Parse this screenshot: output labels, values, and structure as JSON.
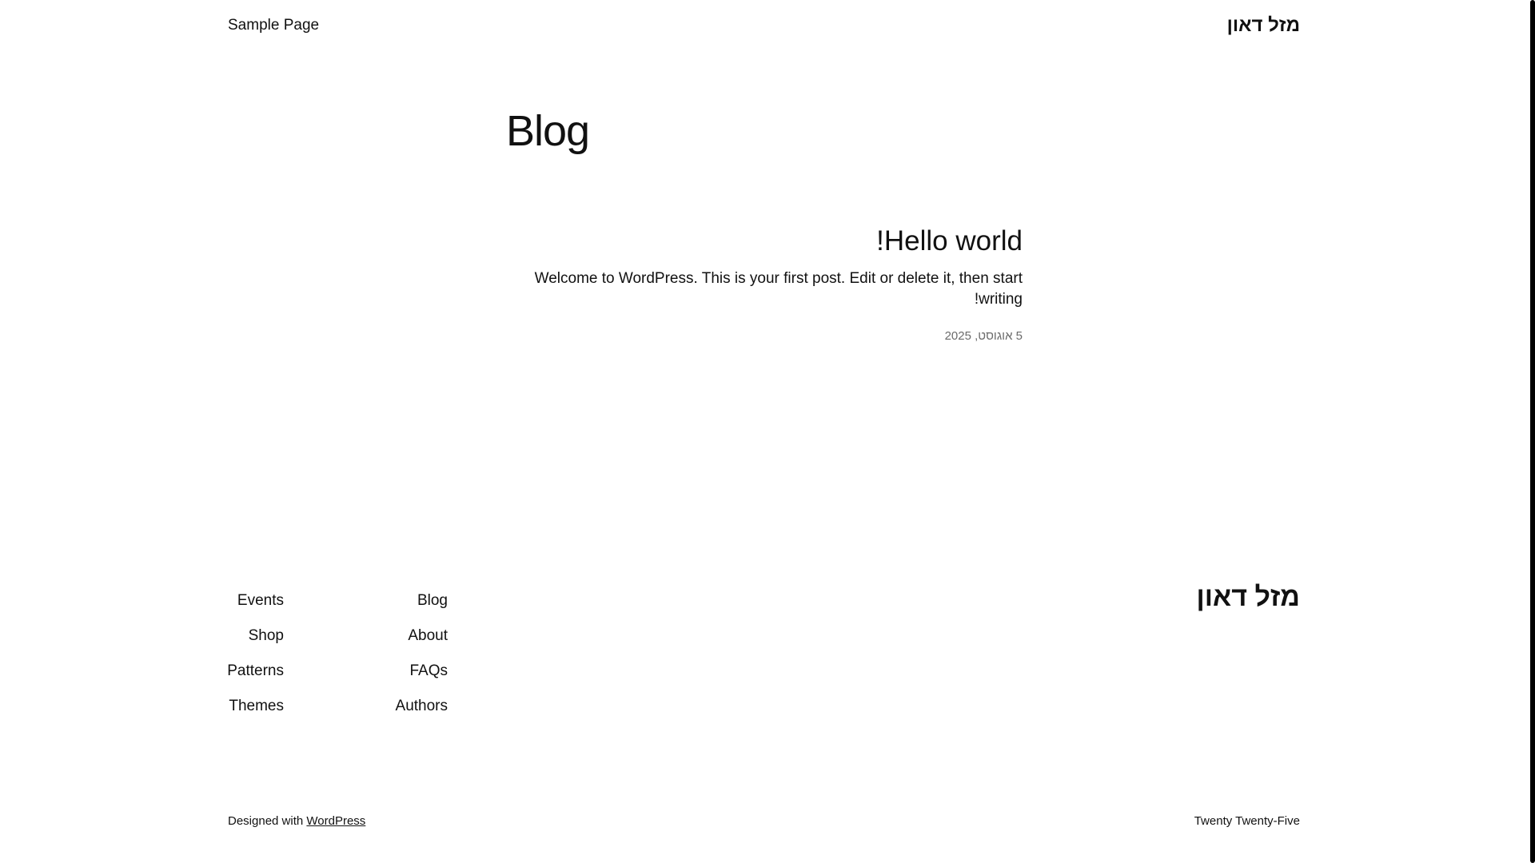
{
  "header": {
    "nav_item": "Sample Page",
    "site_title": "מזל דאון"
  },
  "main": {
    "heading": "Blog",
    "post": {
      "title": "Hello world!",
      "excerpt": "Welcome to WordPress. This is your first post. Edit or delete it, then start writing!",
      "date": "5 אוגוסט, 2025"
    }
  },
  "footer": {
    "site_title": "מזל דאון",
    "nav_col_1": [
      "Blog",
      "About",
      "FAQs",
      "Authors"
    ],
    "nav_col_2": [
      "Events",
      "Shop",
      "Patterns",
      "Themes"
    ],
    "credit_prefix": "Designed with",
    "credit_link": "WordPress",
    "theme_name": "Twenty Twenty-Five"
  },
  "colors": {
    "text": "#111111",
    "muted": "#6b6b6b",
    "background": "#ffffff"
  }
}
